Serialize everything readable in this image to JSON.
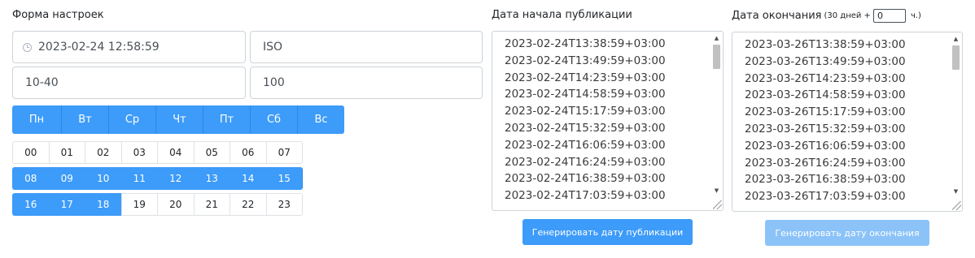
{
  "left": {
    "title": "Форма настроек",
    "datetime_value": "2023-02-24 12:58:59",
    "format_value": "ISO",
    "range_value": "10-40",
    "count_value": "100",
    "days": [
      "Пн",
      "Вт",
      "Ср",
      "Чт",
      "Пт",
      "Сб",
      "Вс"
    ],
    "days_selected": [
      true,
      true,
      true,
      true,
      true,
      true,
      true
    ],
    "hours": [
      [
        "00",
        "01",
        "02",
        "03",
        "04",
        "05",
        "06",
        "07"
      ],
      [
        "08",
        "09",
        "10",
        "11",
        "12",
        "13",
        "14",
        "15"
      ],
      [
        "16",
        "17",
        "18",
        "19",
        "20",
        "21",
        "22",
        "23"
      ]
    ],
    "hours_selected": [
      "08",
      "09",
      "10",
      "11",
      "12",
      "13",
      "14",
      "15",
      "16",
      "17",
      "18"
    ]
  },
  "start": {
    "title": "Дата начала публикации",
    "lines": [
      "2023-02-24T13:38:59+03:00",
      "2023-02-24T13:49:59+03:00",
      "2023-02-24T14:23:59+03:00",
      "2023-02-24T14:58:59+03:00",
      "2023-02-24T15:17:59+03:00",
      "2023-02-24T15:32:59+03:00",
      "2023-02-24T16:06:59+03:00",
      "2023-02-24T16:24:59+03:00",
      "2023-02-24T16:38:59+03:00",
      "2023-02-24T17:03:59+03:00"
    ],
    "button_label": "Генерировать дату публикации"
  },
  "end": {
    "title": "Дата окончания",
    "days_note": "(30 дней +",
    "hours_value": "0",
    "hours_suffix": "ч.)",
    "lines": [
      "2023-03-26T13:38:59+03:00",
      "2023-03-26T13:49:59+03:00",
      "2023-03-26T14:23:59+03:00",
      "2023-03-26T14:58:59+03:00",
      "2023-03-26T15:17:59+03:00",
      "2023-03-26T15:32:59+03:00",
      "2023-03-26T16:06:59+03:00",
      "2023-03-26T16:24:59+03:00",
      "2023-03-26T16:38:59+03:00",
      "2023-03-26T17:03:59+03:00"
    ],
    "button_label": "Генерировать дату окончания"
  },
  "colors": {
    "accent": "#3d9bf9",
    "accent_disabled": "#8bc3f9",
    "border": "#ced4da"
  },
  "icons": {
    "datetime": "clock-icon",
    "scroll_up": "arrow-up-icon",
    "scroll_down": "arrow-down-icon",
    "resize": "resize-grip-icon"
  }
}
